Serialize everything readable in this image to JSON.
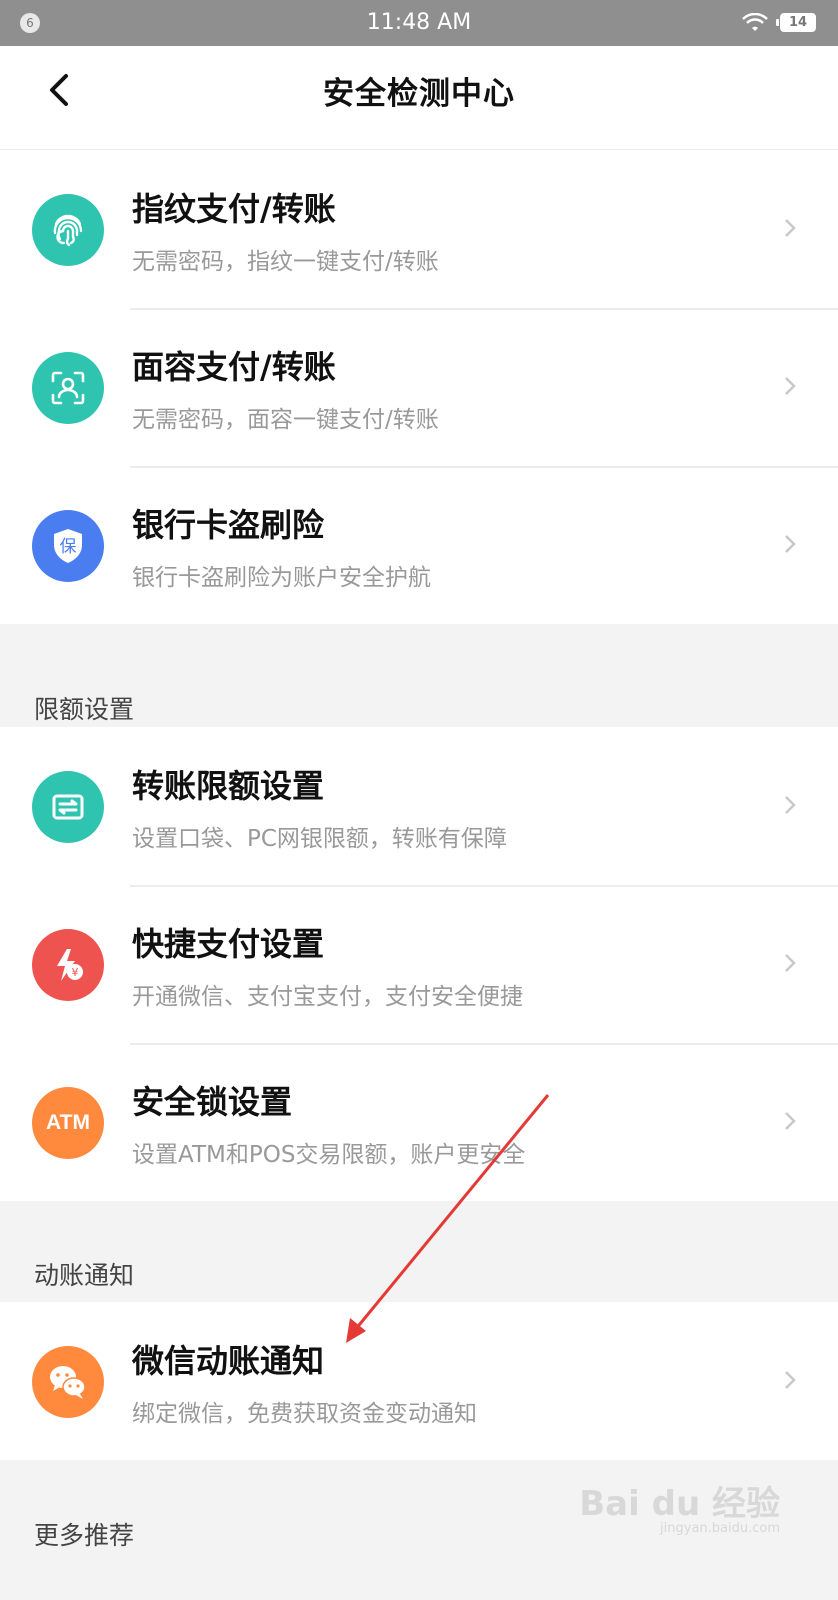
{
  "status_bar": {
    "notification_count": "6",
    "time": "11:48 AM",
    "battery": "14"
  },
  "header": {
    "title": "安全检测中心"
  },
  "groups": {
    "payment": {
      "items": [
        {
          "title": "指纹支付/转账",
          "subtitle": "无需密码，指纹一键支付/转账",
          "icon": "fingerprint-icon",
          "color": "#2ec4b0"
        },
        {
          "title": "面容支付/转账",
          "subtitle": "无需密码，面容一键支付/转账",
          "icon": "face-id-icon",
          "color": "#2ec4b0"
        },
        {
          "title": "银行卡盗刷险",
          "subtitle": "银行卡盗刷险为账户安全护航",
          "icon": "shield-icon",
          "color": "#4a7ef0",
          "icon_text": "保"
        }
      ]
    },
    "limits": {
      "label": "限额设置",
      "items": [
        {
          "title": "转账限额设置",
          "subtitle": "设置口袋、PC网银限额，转账有保障",
          "icon": "transfer-icon",
          "color": "#2ec4b0"
        },
        {
          "title": "快捷支付设置",
          "subtitle": "开通微信、支付宝支付，支付安全便捷",
          "icon": "quick-pay-icon",
          "color": "#ef5350"
        },
        {
          "title": "安全锁设置",
          "subtitle": "设置ATM和POS交易限额，账户更安全",
          "icon": "atm-icon",
          "color": "#ff8a3d",
          "icon_text": "ATM"
        }
      ]
    },
    "notify": {
      "label": "动账通知",
      "items": [
        {
          "title": "微信动账通知",
          "subtitle": "绑定微信，免费获取资金变动通知",
          "icon": "wechat-icon",
          "color": "#ff8a3d"
        }
      ]
    },
    "more": {
      "label": "更多推荐"
    }
  },
  "watermark": {
    "brand": "Bai du 经验",
    "url": "jingyan.baidu.com"
  },
  "colors": {
    "accent_teal": "#2ec4b0",
    "accent_blue": "#4a7ef0",
    "accent_red": "#ef5350",
    "accent_orange": "#ff8a3d",
    "annotation_arrow": "#e53935"
  }
}
